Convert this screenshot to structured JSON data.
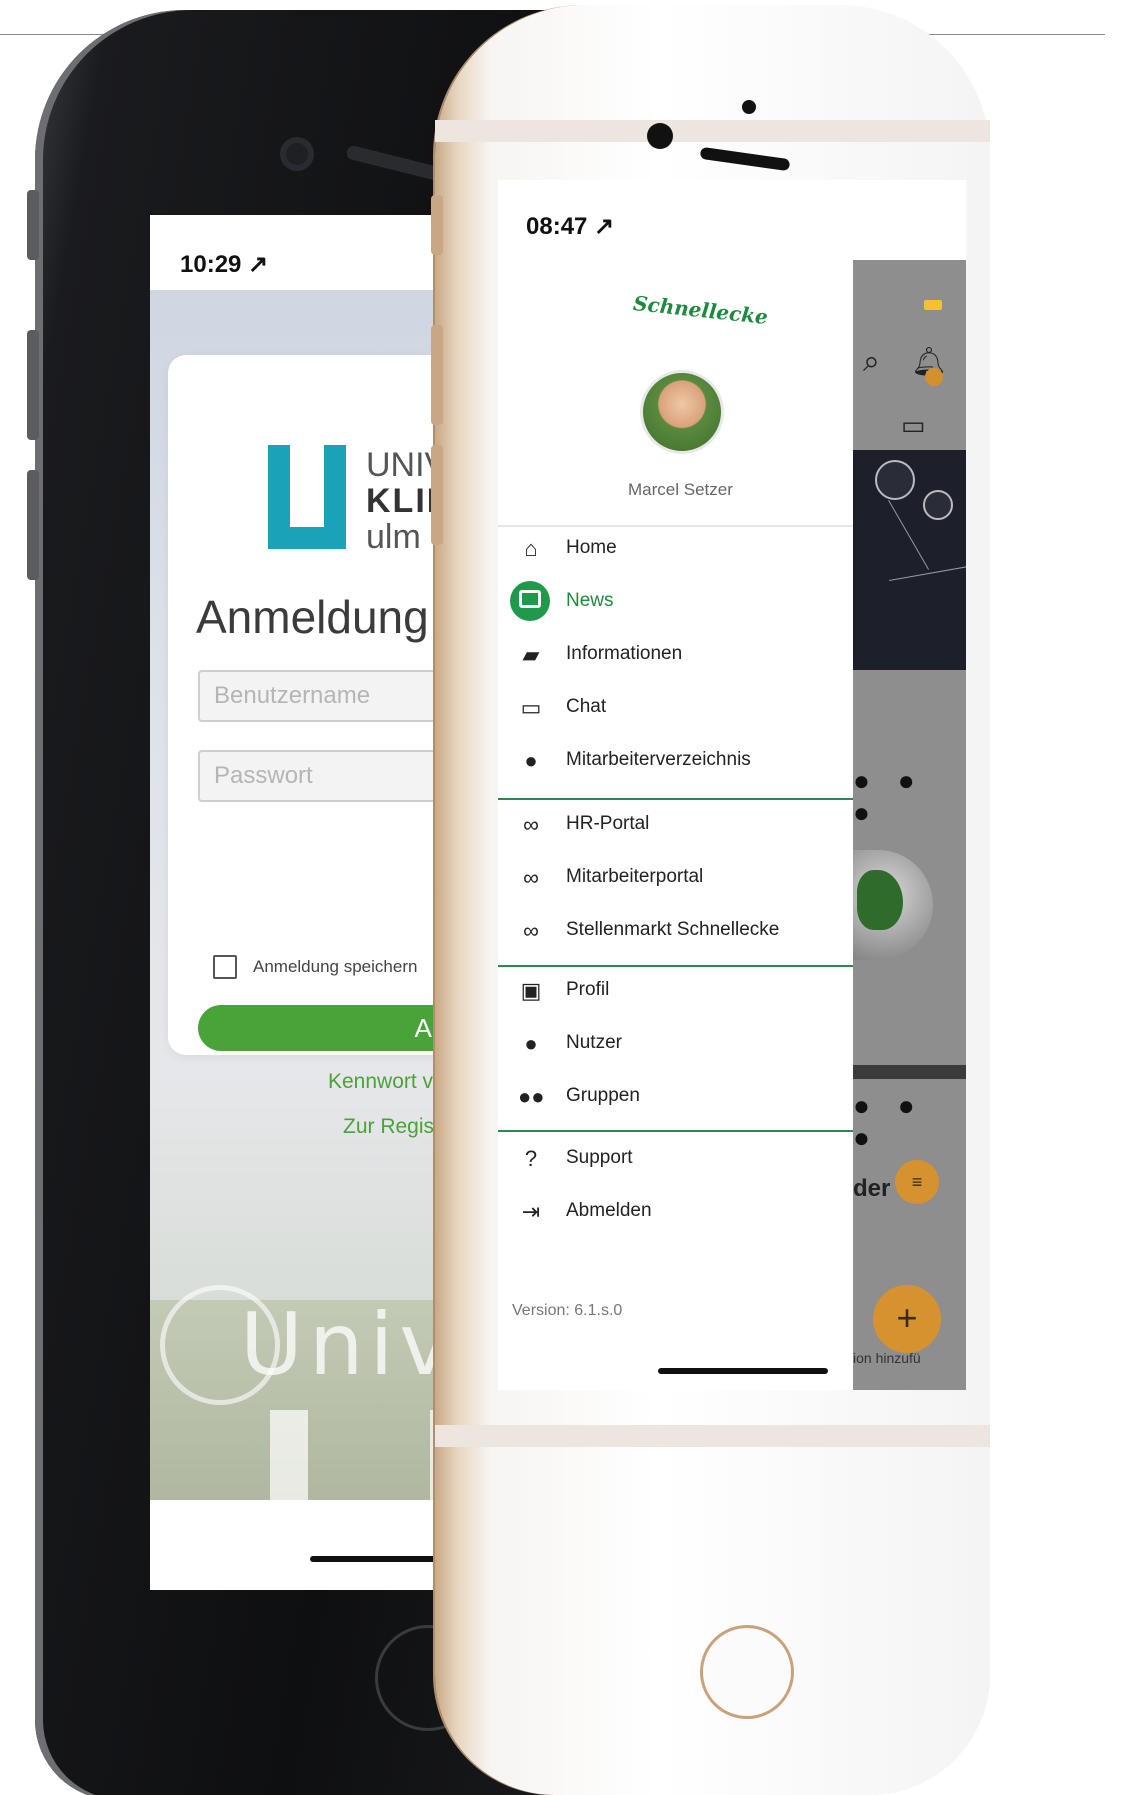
{
  "phone_left": {
    "status_time": "10:29 ↗",
    "logo": {
      "line1": "UNIVERSIT",
      "line2": "KLINIKUM",
      "line3": "ulm"
    },
    "login": {
      "title": "Anmeldung",
      "username_placeholder": "Benutzername",
      "password_placeholder": "Passwort",
      "remember_label": "Anmeldung speichern",
      "submit_label": "Anmelden",
      "forgot_label": "Kennwort vergessen",
      "register_label": "Zur Registrierung"
    },
    "background_sign": "Universit"
  },
  "phone_right": {
    "status_time": "08:47 ↗",
    "brand_logo": "Schnellecke",
    "user_name": "Marcel Setzer",
    "menu_sections": [
      [
        {
          "label": "Home",
          "icon": "home-icon",
          "active": false
        },
        {
          "label": "News",
          "icon": "news-icon",
          "active": true
        },
        {
          "label": "Informationen",
          "icon": "folder-icon",
          "active": false
        },
        {
          "label": "Chat",
          "icon": "chat-icon",
          "active": false
        },
        {
          "label": "Mitarbeiterverzeichnis",
          "icon": "person-icon",
          "active": false
        }
      ],
      [
        {
          "label": "HR-Portal",
          "icon": "link-icon"
        },
        {
          "label": "Mitarbeiterportal",
          "icon": "link-icon"
        },
        {
          "label": "Stellenmarkt Schnellecke",
          "icon": "link-icon"
        }
      ],
      [
        {
          "label": "Profil",
          "icon": "profile-icon"
        },
        {
          "label": "Nutzer",
          "icon": "person-icon"
        },
        {
          "label": "Gruppen",
          "icon": "group-icon"
        }
      ],
      [
        {
          "label": "Support",
          "icon": "help-icon"
        },
        {
          "label": "Abmelden",
          "icon": "logout-icon"
        }
      ]
    ],
    "version": "Version: 6.1.s.0",
    "background_app": {
      "partial_heading": "der",
      "partial_text": "ion hinzufü"
    }
  },
  "colors": {
    "uniklinik_teal": "#1aa3b8",
    "login_green": "#4aa338",
    "schnellecke_green": "#1e8a3d",
    "fab_orange": "#d6922e"
  }
}
